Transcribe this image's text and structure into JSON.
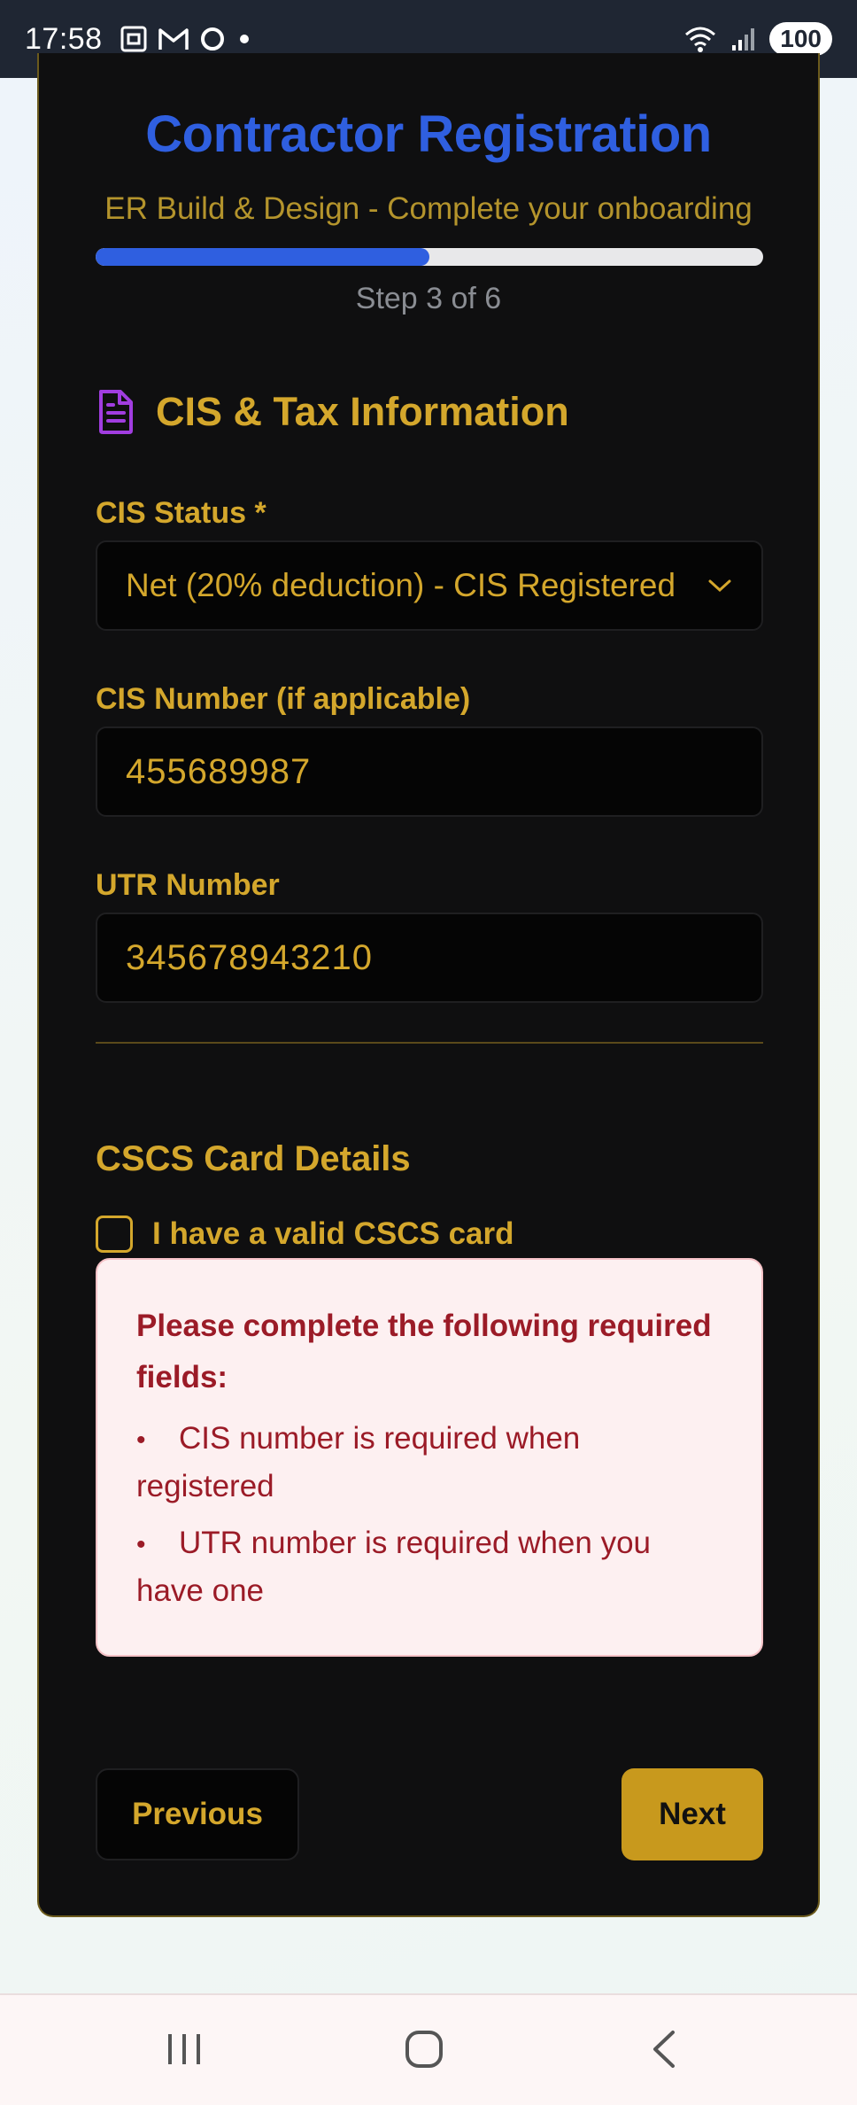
{
  "status_bar": {
    "time": "17:58",
    "battery": "100",
    "notification_icons": [
      "screenshot-icon",
      "gmail-icon",
      "circle-app-icon",
      "dot-icon"
    ],
    "system_icons": [
      "wifi-icon",
      "signal-icon",
      "battery-icon"
    ]
  },
  "header": {
    "title": "Contractor Registration",
    "subtitle": "ER Build & Design - Complete your onboarding",
    "step_text": "Step 3 of 6",
    "progress": 0.5
  },
  "section": {
    "icon": "document-icon",
    "title": "CIS & Tax Information"
  },
  "form": {
    "cis_status": {
      "label": "CIS Status *",
      "value": "Net (20% deduction) - CIS Registered"
    },
    "cis_number": {
      "label": "CIS Number (if applicable)",
      "value": "455689987"
    },
    "utr_number": {
      "label": "UTR Number",
      "value": "345678943210"
    },
    "cscs": {
      "heading": "CSCS Card Details",
      "checkbox_label": "I have a valid CSCS card",
      "checked": false
    }
  },
  "errors": {
    "title": "Please complete the following required fields:",
    "items": [
      "CIS number is required when registered",
      "UTR number is required when you have one"
    ]
  },
  "buttons": {
    "previous": "Previous",
    "next": "Next"
  },
  "colors": {
    "accent_gold": "#d4a72c",
    "title_blue": "#2f5fe0",
    "card_bg": "#0f0f10",
    "error_text": "#9b1b27",
    "error_bg": "#fdf0f1",
    "next_button": "#c8991d"
  },
  "nav_bar": {
    "icons": [
      "recent-apps-icon",
      "home-icon",
      "back-icon"
    ]
  }
}
